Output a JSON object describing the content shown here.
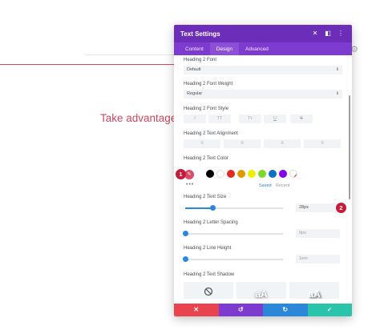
{
  "background": {
    "headline": "Take advantage o"
  },
  "modal": {
    "title": "Text Settings",
    "tabs": [
      {
        "label": "Content",
        "active": false
      },
      {
        "label": "Design",
        "active": true
      },
      {
        "label": "Advanced",
        "active": false
      }
    ],
    "font": {
      "label": "Heading 2 Font",
      "value": "Default"
    },
    "font_weight": {
      "label": "Heading 2 Font Weight",
      "value": "Regular"
    },
    "font_style": {
      "label": "Heading 2 Font Style",
      "buttons": [
        "I",
        "TT",
        "Tт",
        "U",
        "S"
      ]
    },
    "text_alignment": {
      "label": "Heading 2 Text Alignment"
    },
    "text_color": {
      "label": "Heading 2 Text Color",
      "swatches": [
        "#000000",
        "#ffffff",
        "#e02b20",
        "#e09900",
        "#edf000",
        "#7cda24",
        "#0c71c3",
        "#8300e9"
      ],
      "more": "•••",
      "saved_label": "Saved",
      "recent_label": "Recent"
    },
    "text_size": {
      "label": "Heading 2 Text Size",
      "value": "28px",
      "level": 0.28
    },
    "letter_spacing": {
      "label": "Heading 2 Letter Spacing",
      "value": "0px",
      "level": 0
    },
    "line_height": {
      "label": "Heading 2 Line Height",
      "value": "1em",
      "level": 0
    },
    "text_shadow": {
      "label": "Heading 2 Text Shadow",
      "options": [
        "aA",
        "aA"
      ]
    },
    "badges": [
      "1",
      "2"
    ]
  },
  "colors": {
    "header": "#6c2eb9",
    "tabs": "#7d3bcf",
    "accent": "#2b87da",
    "badge": "#c81b3c",
    "cancel": "#e9434f",
    "undo": "#7e3bd0",
    "redo": "#2b87da",
    "save": "#29c4a9"
  }
}
